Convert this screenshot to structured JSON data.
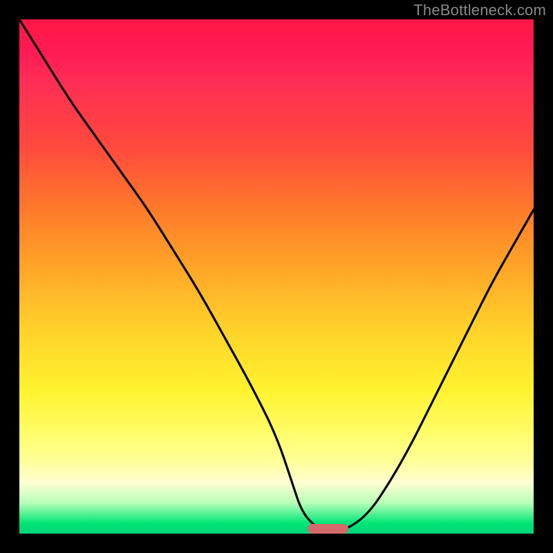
{
  "watermark": "TheBottleneck.com",
  "chart_data": {
    "type": "line",
    "title": "",
    "xlabel": "",
    "ylabel": "",
    "xlim": [
      0,
      100
    ],
    "ylim": [
      0,
      100
    ],
    "grid": false,
    "legend": false,
    "series": [
      {
        "name": "bottleneck-curve",
        "x": [
          0,
          5,
          10,
          15,
          20,
          25,
          30,
          35,
          40,
          45,
          50,
          53,
          55,
          58,
          60,
          64,
          68,
          72,
          76,
          80,
          84,
          88,
          92,
          96,
          100
        ],
        "y": [
          100,
          92,
          84,
          77,
          70,
          63,
          55,
          47,
          38,
          29,
          19,
          10,
          4,
          1,
          0,
          1,
          4,
          10,
          17,
          25,
          33,
          41,
          49,
          56,
          63
        ]
      }
    ],
    "background_gradient": {
      "stops": [
        {
          "pos": 0.0,
          "color": "#ff1744"
        },
        {
          "pos": 0.25,
          "color": "#ff4a3d"
        },
        {
          "pos": 0.5,
          "color": "#ffa428"
        },
        {
          "pos": 0.72,
          "color": "#fff22e"
        },
        {
          "pos": 0.9,
          "color": "#fffed2"
        },
        {
          "pos": 1.0,
          "color": "#00d47a"
        }
      ]
    },
    "optimal_marker": {
      "x_center": 60,
      "width": 8,
      "color": "#d46a6a"
    }
  }
}
